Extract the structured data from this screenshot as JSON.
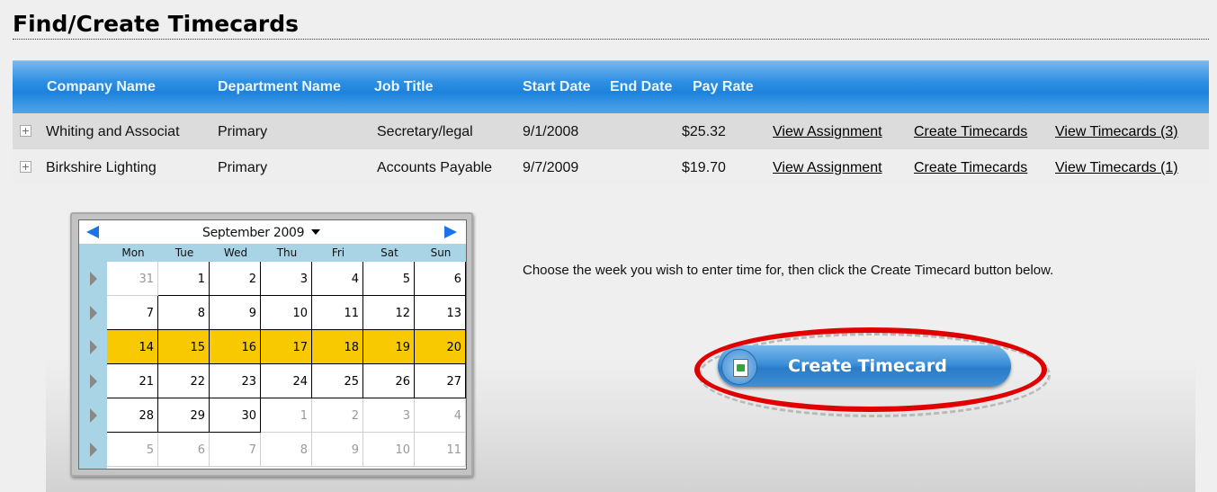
{
  "page": {
    "title": "Find/Create Timecards"
  },
  "grid": {
    "columns": [
      "Company Name",
      "Department Name",
      "Job Title",
      "Start Date",
      "End Date",
      "Pay Rate"
    ],
    "rows": [
      {
        "company": "Whiting and Associat",
        "department": "Primary",
        "job_title": "Secretary/legal",
        "start_date": "9/1/2008",
        "end_date": "",
        "pay_rate": "$25.32",
        "view_assignment": "View Assignment",
        "create_timecards": "Create Timecards",
        "view_timecards": "View Timecards (3)"
      },
      {
        "company": "Birkshire Lighting",
        "department": "Primary",
        "job_title": "Accounts Payable",
        "start_date": "9/7/2009",
        "end_date": "",
        "pay_rate": "$19.70",
        "view_assignment": "View Assignment",
        "create_timecards": "Create Timecards",
        "view_timecards": "View Timecards (1)"
      }
    ],
    "expand_glyph": "+"
  },
  "calendar": {
    "month_label": "September 2009",
    "prev_icon": "arrow-left-icon",
    "next_icon": "arrow-right-icon",
    "day_names": [
      "Mon",
      "Tue",
      "Wed",
      "Thu",
      "Fri",
      "Sat",
      "Sun"
    ],
    "selected_week": 2,
    "weeks": [
      [
        {
          "d": "31",
          "o": true
        },
        {
          "d": "1"
        },
        {
          "d": "2"
        },
        {
          "d": "3"
        },
        {
          "d": "4"
        },
        {
          "d": "5"
        },
        {
          "d": "6"
        }
      ],
      [
        {
          "d": "7"
        },
        {
          "d": "8"
        },
        {
          "d": "9"
        },
        {
          "d": "10"
        },
        {
          "d": "11"
        },
        {
          "d": "12"
        },
        {
          "d": "13"
        }
      ],
      [
        {
          "d": "14"
        },
        {
          "d": "15"
        },
        {
          "d": "16"
        },
        {
          "d": "17"
        },
        {
          "d": "18"
        },
        {
          "d": "19"
        },
        {
          "d": "20"
        }
      ],
      [
        {
          "d": "21"
        },
        {
          "d": "22"
        },
        {
          "d": "23"
        },
        {
          "d": "24"
        },
        {
          "d": "25"
        },
        {
          "d": "26"
        },
        {
          "d": "27"
        }
      ],
      [
        {
          "d": "28"
        },
        {
          "d": "29"
        },
        {
          "d": "30"
        },
        {
          "d": "1",
          "o": true
        },
        {
          "d": "2",
          "o": true
        },
        {
          "d": "3",
          "o": true
        },
        {
          "d": "4",
          "o": true
        }
      ],
      [
        {
          "d": "5",
          "o": true
        },
        {
          "d": "6",
          "o": true
        },
        {
          "d": "7",
          "o": true
        },
        {
          "d": "8",
          "o": true
        },
        {
          "d": "9",
          "o": true
        },
        {
          "d": "10",
          "o": true
        },
        {
          "d": "11",
          "o": true
        }
      ]
    ]
  },
  "instruction": "Choose the week you wish to enter time for, then click the Create Timecard button below.",
  "create_button": {
    "label": "Create Timecard",
    "icon": "document-arrow-icon"
  },
  "colors": {
    "header_blue": "#1e82dc",
    "highlight": "#f9c900",
    "ring_red": "#e10000"
  }
}
